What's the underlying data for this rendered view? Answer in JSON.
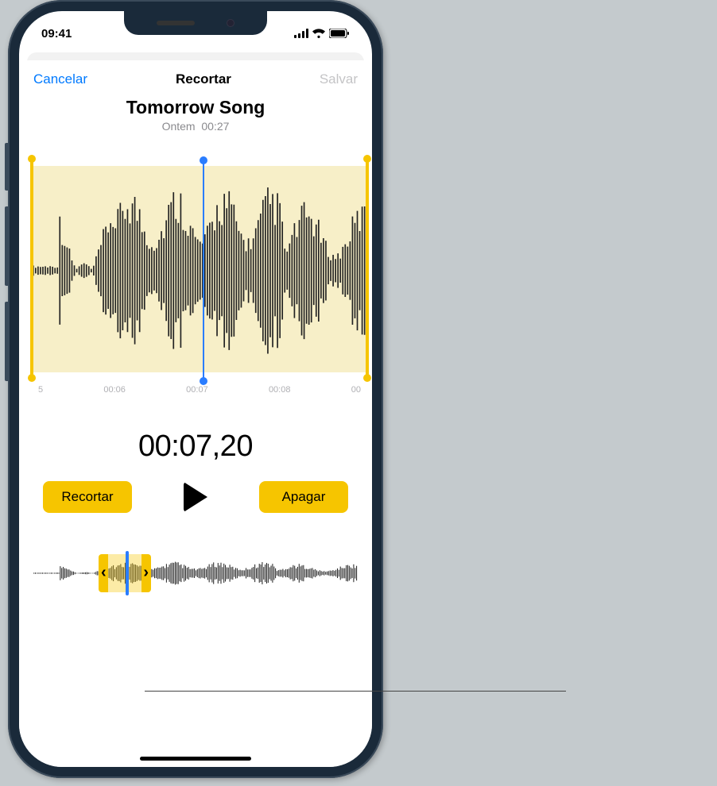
{
  "status": {
    "time": "09:41"
  },
  "nav": {
    "cancel": "Cancelar",
    "title": "Recortar",
    "save": "Salvar"
  },
  "recording": {
    "title": "Tomorrow Song",
    "when": "Ontem",
    "duration": "00:27"
  },
  "ticks": [
    "5",
    "00:06",
    "00:07",
    "00:08",
    "00"
  ],
  "playhead_time": "00:07,20",
  "buttons": {
    "trim": "Recortar",
    "delete": "Apagar"
  },
  "colors": {
    "accent": "#f6c500",
    "link": "#007aff",
    "playhead": "#2a7dff"
  }
}
